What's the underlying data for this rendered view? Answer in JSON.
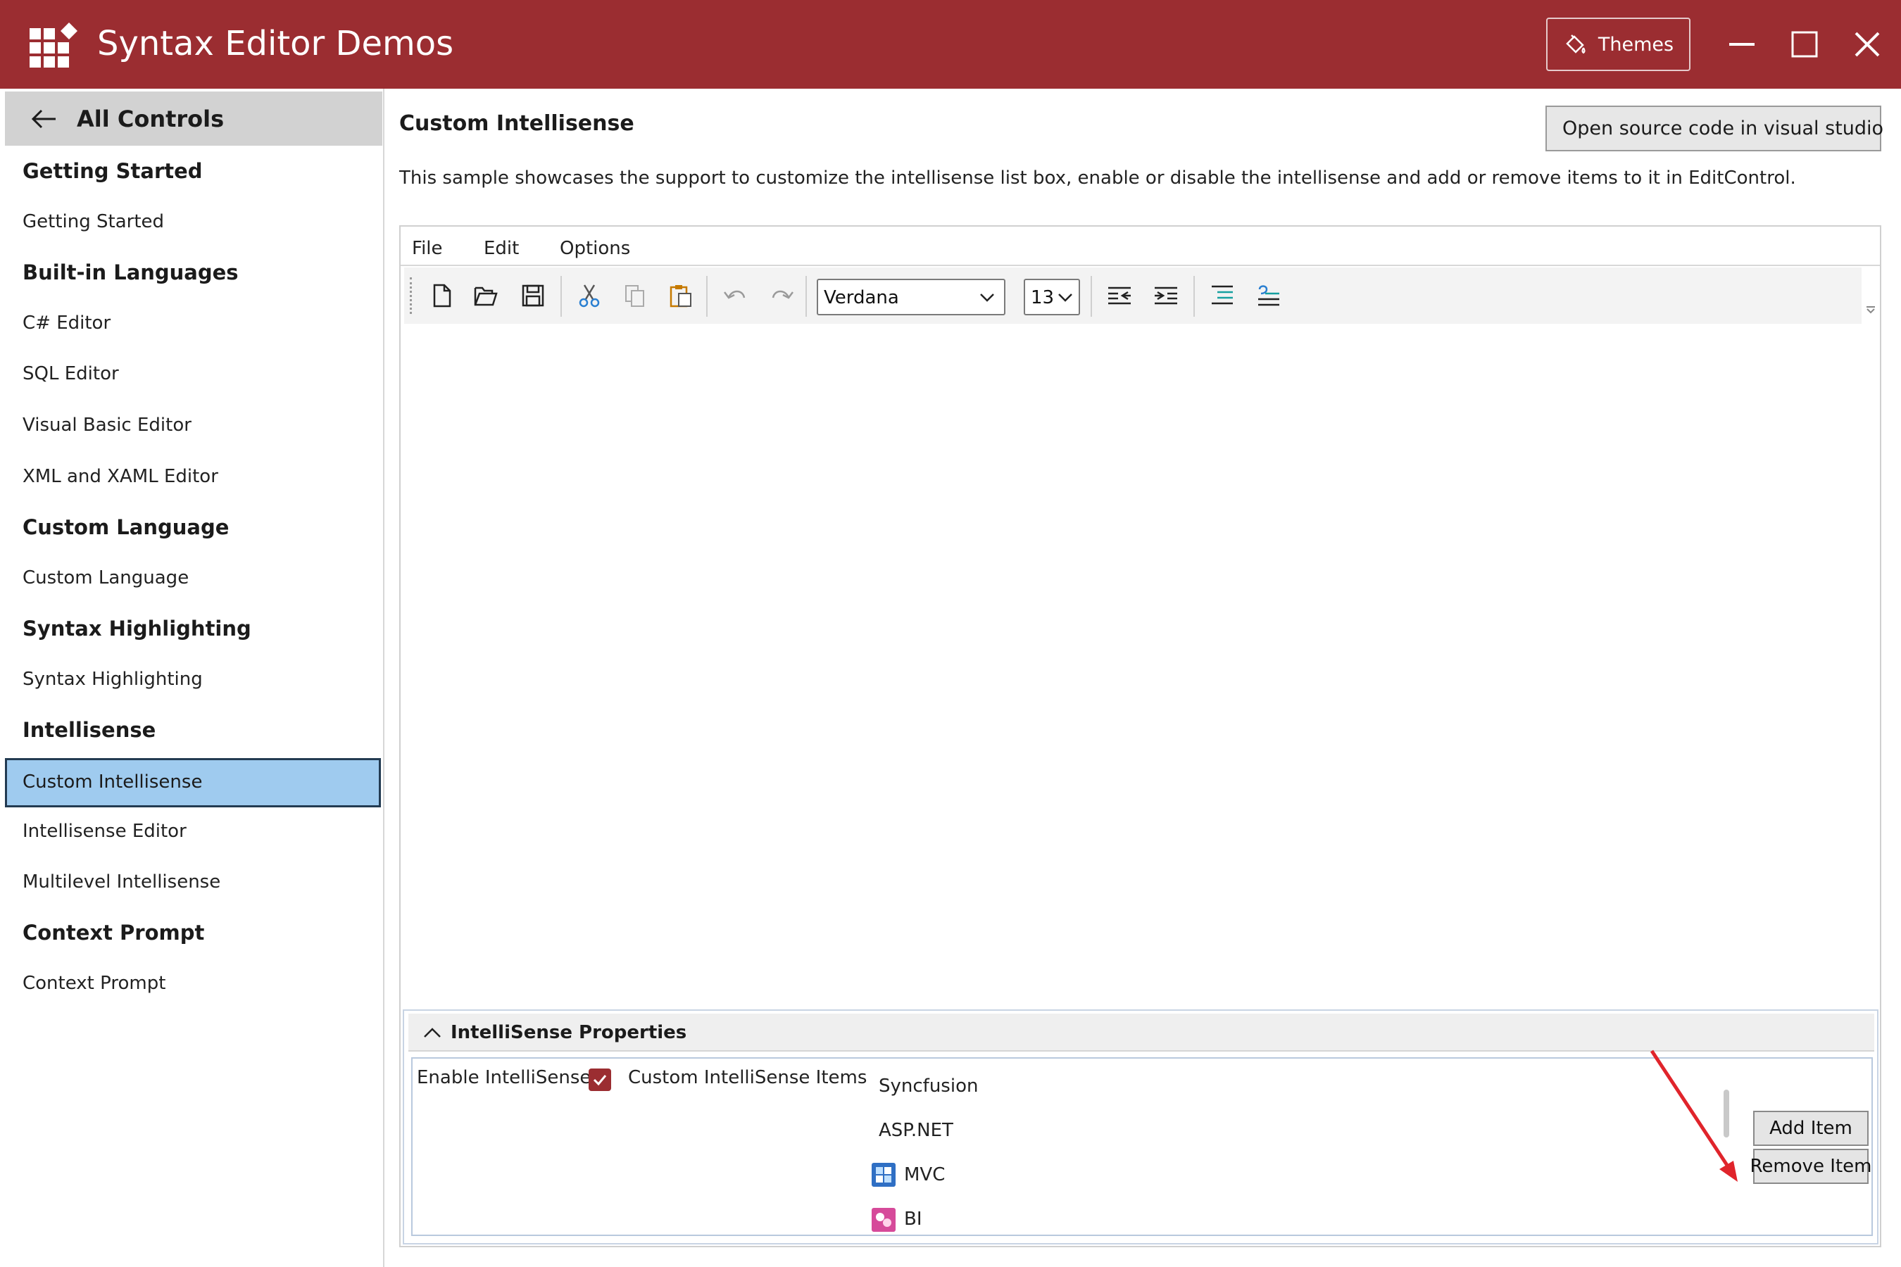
{
  "window": {
    "title": "Syntax Editor Demos",
    "themes_label": "Themes",
    "accent_color": "#9b2d31"
  },
  "sidebar": {
    "back_label": "All Controls",
    "items": [
      {
        "label": "Getting Started",
        "type": "header"
      },
      {
        "label": "Getting Started",
        "type": "item"
      },
      {
        "label": "Built-in Languages",
        "type": "header"
      },
      {
        "label": "C# Editor",
        "type": "item"
      },
      {
        "label": "SQL Editor",
        "type": "item"
      },
      {
        "label": "Visual Basic Editor",
        "type": "item"
      },
      {
        "label": "XML and XAML Editor",
        "type": "item"
      },
      {
        "label": "Custom Language",
        "type": "header"
      },
      {
        "label": "Custom Language",
        "type": "item"
      },
      {
        "label": "Syntax Highlighting",
        "type": "header"
      },
      {
        "label": "Syntax Highlighting",
        "type": "item"
      },
      {
        "label": "Intellisense",
        "type": "header"
      },
      {
        "label": "Custom Intellisense",
        "type": "item",
        "selected": true
      },
      {
        "label": "Intellisense Editor",
        "type": "item"
      },
      {
        "label": "Multilevel Intellisense",
        "type": "item"
      },
      {
        "label": "Context Prompt",
        "type": "header"
      },
      {
        "label": "Context Prompt",
        "type": "item"
      }
    ]
  },
  "main": {
    "title": "Custom Intellisense",
    "open_source_label": "Open source code in visual studio",
    "description": "This sample showcases the support to customize the intellisense list box, enable or disable the intellisense and add or remove items to it in EditControl."
  },
  "editor": {
    "menu": [
      "File",
      "Edit",
      "Options"
    ],
    "toolbar_icons": [
      "new-file-icon",
      "open-folder-icon",
      "save-icon",
      "cut-icon",
      "copy-icon",
      "paste-icon",
      "undo-icon",
      "redo-icon",
      "outdent-icon",
      "indent-icon",
      "comment-icon",
      "uncomment-icon"
    ],
    "font": "Verdana",
    "font_size": "13"
  },
  "properties": {
    "title": "IntelliSense Properties",
    "enable_label": "Enable IntelliSense",
    "enable_checked": true,
    "items_label": "Custom IntelliSense Items",
    "items": [
      {
        "label": "Syncfusion",
        "icon": ""
      },
      {
        "label": "ASP.NET",
        "icon": ""
      },
      {
        "label": "MVC",
        "icon": "mvc-icon"
      },
      {
        "label": "BI",
        "icon": "bi-icon"
      }
    ],
    "add_label": "Add Item",
    "remove_label": "Remove Item"
  }
}
